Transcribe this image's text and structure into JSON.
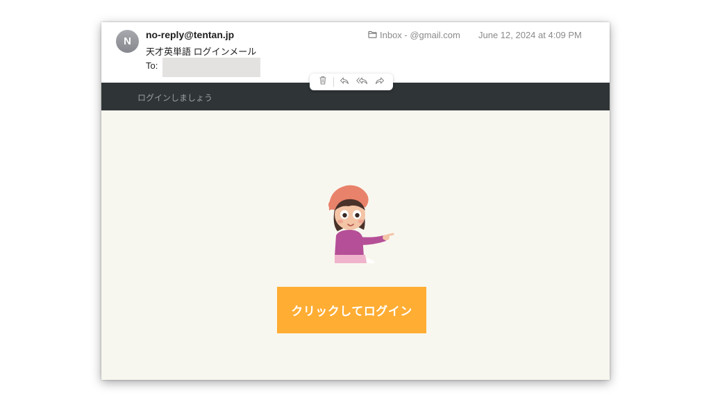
{
  "email": {
    "avatar_initial": "N",
    "sender": "no-reply@tentan.jp",
    "subject": "天才英単語 ログインメール",
    "to_label": "To:",
    "mailbox": "Inbox - @gmail.com",
    "date": "June 12, 2024 at 4:09 PM"
  },
  "toolbar": {
    "icons": [
      "trash-icon",
      "reply-icon",
      "reply-all-icon",
      "forward-icon"
    ]
  },
  "content": {
    "banner_text": "ログインしましょう",
    "login_button_label": "クリックしてログイン",
    "accent_color": "#ffad33",
    "banner_color": "#2f3436",
    "background_color": "#f8f7ef"
  }
}
